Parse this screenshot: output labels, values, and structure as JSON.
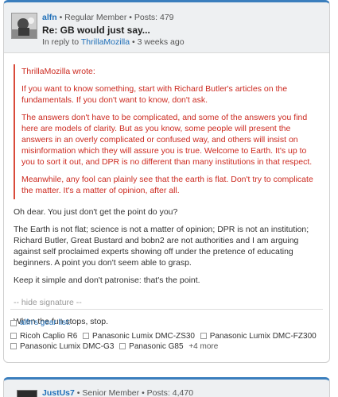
{
  "post1": {
    "author": "alfn",
    "meta_suffix": " • Regular Member • Posts: 479",
    "title": "Re: GB would just say...",
    "reply_prefix": "In reply to ",
    "reply_to": "ThrillaMozilla",
    "reply_suffix": " • 3 weeks ago",
    "quote": {
      "header": "ThrillaMozilla wrote:",
      "paragraphs": [
        "If you want to know something, start with Richard Butler's articles on the fundamentals. If you don't want to know, don't ask.",
        "The answers don't have to be complicated, and some of the answers you find here are models of clarity. But as you know, some people will present the answers in an overly complicated or confused way, and others will insist on misinformation which they will assure you is true. Welcome to Earth. It's up to you to sort it out, and DPR is no different than many institutions in that respect.",
        "Meanwhile, any fool can plainly see that the earth is flat. Don't try to complicate the matter. It's a matter of opinion, after all."
      ]
    },
    "body": [
      "Oh dear. You just don't get the point do you?",
      "The Earth is not flat; science is not a matter of opinion; DPR is not an institution; Richard Butler, Great Bustard and bobn2 are not authorities and I am arguing against self proclaimed experts showing off under the pretence of educating beginners. A point you don't seem able to grasp.",
      "Keep it simple and don't patronise: that's the point."
    ],
    "hide_signature": "-- hide signature --",
    "signature": "When the fun stops, stop.",
    "gear_title": "alfn's gear list:",
    "gear": [
      "Ricoh Caplio R6",
      "Panasonic Lumix DMC-ZS30",
      "Panasonic Lumix DMC-FZ300",
      "Panasonic Lumix DMC-G3",
      "Panasonic G85"
    ],
    "gear_more": "+4 more"
  },
  "post2": {
    "author": "JustUs7",
    "meta_suffix": " • Senior Member • Posts: 4,470"
  },
  "colors": {
    "accent": "#3a7ebd",
    "link": "#1f6fb8",
    "quote_red": "#cc2a20"
  }
}
